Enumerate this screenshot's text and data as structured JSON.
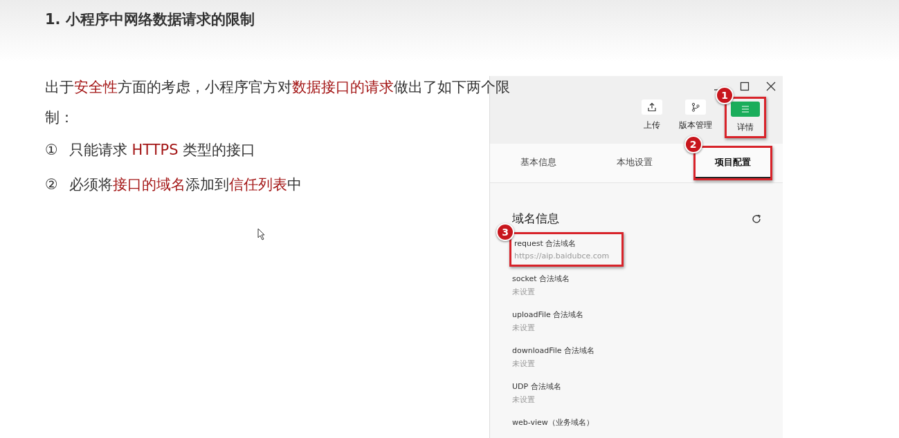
{
  "slide": {
    "title": "1. 小程序中网络数据请求的限制",
    "intro": [
      {
        "text": "出于",
        "highlight": false
      },
      {
        "text": "安全性",
        "highlight": true
      },
      {
        "text": "方面的考虑，小程序官方对",
        "highlight": false
      },
      {
        "text": "数据接口的请求",
        "highlight": true
      },
      {
        "text": "做出了如下两个限制：",
        "highlight": false
      }
    ],
    "rules": [
      {
        "marker": "①",
        "parts": [
          {
            "text": "只能请求 ",
            "highlight": false
          },
          {
            "text": "HTTPS",
            "highlight": true
          },
          {
            "text": " 类型的接口",
            "highlight": false
          }
        ]
      },
      {
        "marker": "②",
        "parts": [
          {
            "text": "必须将",
            "highlight": false
          },
          {
            "text": "接口的域名",
            "highlight": true
          },
          {
            "text": "添加到",
            "highlight": false
          },
          {
            "text": "信任列表",
            "highlight": true
          },
          {
            "text": "中",
            "highlight": false
          }
        ]
      }
    ]
  },
  "devtools": {
    "toolbar": [
      {
        "label": "上传",
        "kind": "upload",
        "active": false
      },
      {
        "label": "版本管理",
        "kind": "branch",
        "active": false
      },
      {
        "label": "详情",
        "kind": "menu",
        "active": true,
        "callout": "1"
      }
    ],
    "tabs": [
      {
        "label": "基本信息",
        "selected": false
      },
      {
        "label": "本地设置",
        "selected": false
      },
      {
        "label": "项目配置",
        "selected": true,
        "callout": "2"
      }
    ],
    "section_title": "域名信息",
    "domains": [
      {
        "label": "request 合法域名",
        "value": "https://aip.baidubce.com",
        "callout": "3"
      },
      {
        "label": "socket 合法域名",
        "value": "未设置"
      },
      {
        "label": "uploadFile 合法域名",
        "value": "未设置"
      },
      {
        "label": "downloadFile 合法域名",
        "value": "未设置"
      },
      {
        "label": "UDP 合法域名",
        "value": "未设置"
      },
      {
        "label": "web-view（业务域名）"
      }
    ]
  }
}
